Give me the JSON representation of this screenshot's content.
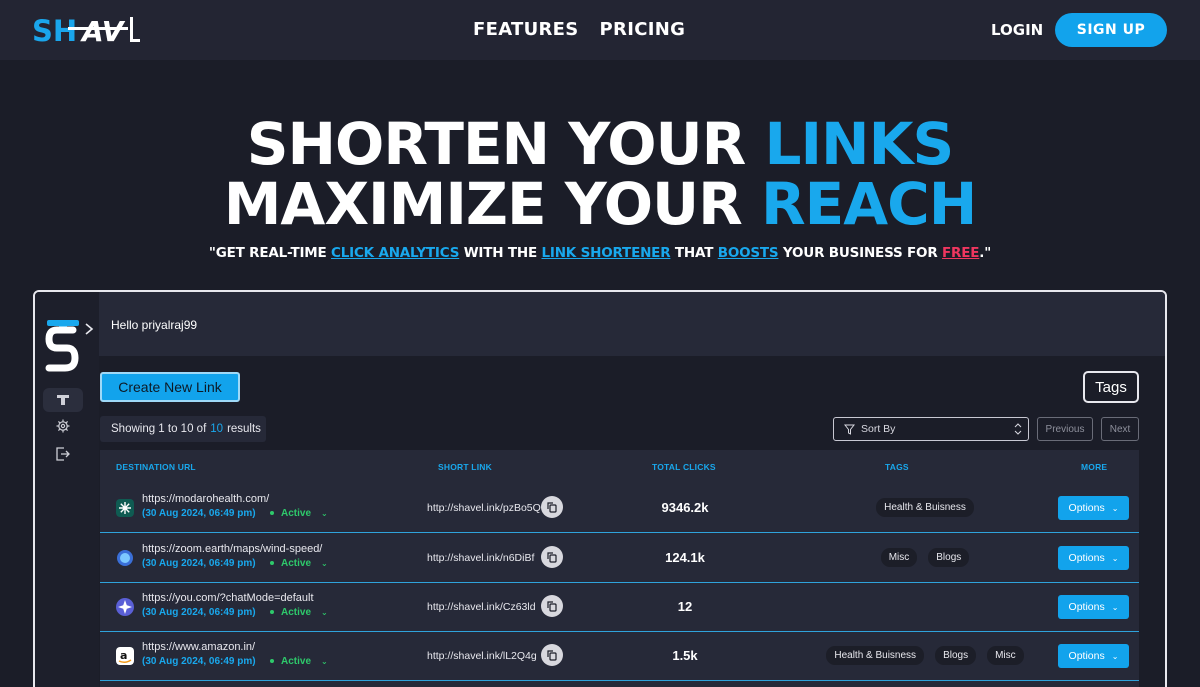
{
  "nav": {
    "logo_text": "SHAVL",
    "links": [
      "FEATURES",
      "PRICING"
    ],
    "login": "LOGIN",
    "signup": "SIGN UP"
  },
  "hero": {
    "line1_plain": "SHORTEN YOUR ",
    "line1_accent": "LINKS",
    "line2_plain": "MAXIMIZE YOUR ",
    "line2_accent": "REACH",
    "tagline": {
      "p1": "\"GET REAL-TIME ",
      "link1": "CLICK ANALYTICS",
      "p2": " WITH THE ",
      "link2": "LINK SHORTENER",
      "p3": " THAT ",
      "link3": "BOOSTS",
      "p4": " YOUR BUSINESS FOR ",
      "free": "FREE",
      "p5": ".\""
    }
  },
  "dashboard": {
    "greeting": "Hello priyalraj99",
    "create_label": "Create New Link",
    "tags_label": "Tags",
    "showing": {
      "prefix": "Showing 1 to 10 of",
      "count": "10",
      "suffix": "results"
    },
    "sort_label": "Sort By",
    "prev_label": "Previous",
    "next_label": "Next",
    "headers": {
      "dest": "DESTINATION URL",
      "short": "SHORT LINK",
      "clicks": "TOTAL CLICKS",
      "tags": "TAGS",
      "more": "MORE"
    },
    "rows": [
      {
        "url": "https://modarohealth.com/",
        "date": "(30 Aug 2024, 06:49 pm)",
        "status": "Active",
        "short": "http://shavel.ink/pzBo5Q",
        "clicks": "9346.2k",
        "tags": [
          "Health & Buisness"
        ],
        "options": "Options"
      },
      {
        "url": "https://zoom.earth/maps/wind-speed/",
        "date": "(30 Aug 2024, 06:49 pm)",
        "status": "Active",
        "short": "http://shavel.ink/n6DiBf",
        "clicks": "124.1k",
        "tags": [
          "Misc",
          "Blogs"
        ],
        "options": "Options"
      },
      {
        "url": "https://you.com/?chatMode=default",
        "date": "(30 Aug 2024, 06:49 pm)",
        "status": "Active",
        "short": "http://shavel.ink/Cz63ld",
        "clicks": "12",
        "tags": [],
        "options": "Options"
      },
      {
        "url": "https://www.amazon.in/",
        "date": "(30 Aug 2024, 06:49 pm)",
        "status": "Active",
        "short": "http://shavel.ink/lL2Q4g",
        "clicks": "1.5k",
        "tags": [
          "Health & Buisness",
          "Blogs",
          "Misc"
        ],
        "options": "Options"
      }
    ]
  },
  "colors": {
    "accent": "#19a8ed",
    "button": "#12a3ec",
    "active": "#2ec96b",
    "free": "#f0365f"
  }
}
